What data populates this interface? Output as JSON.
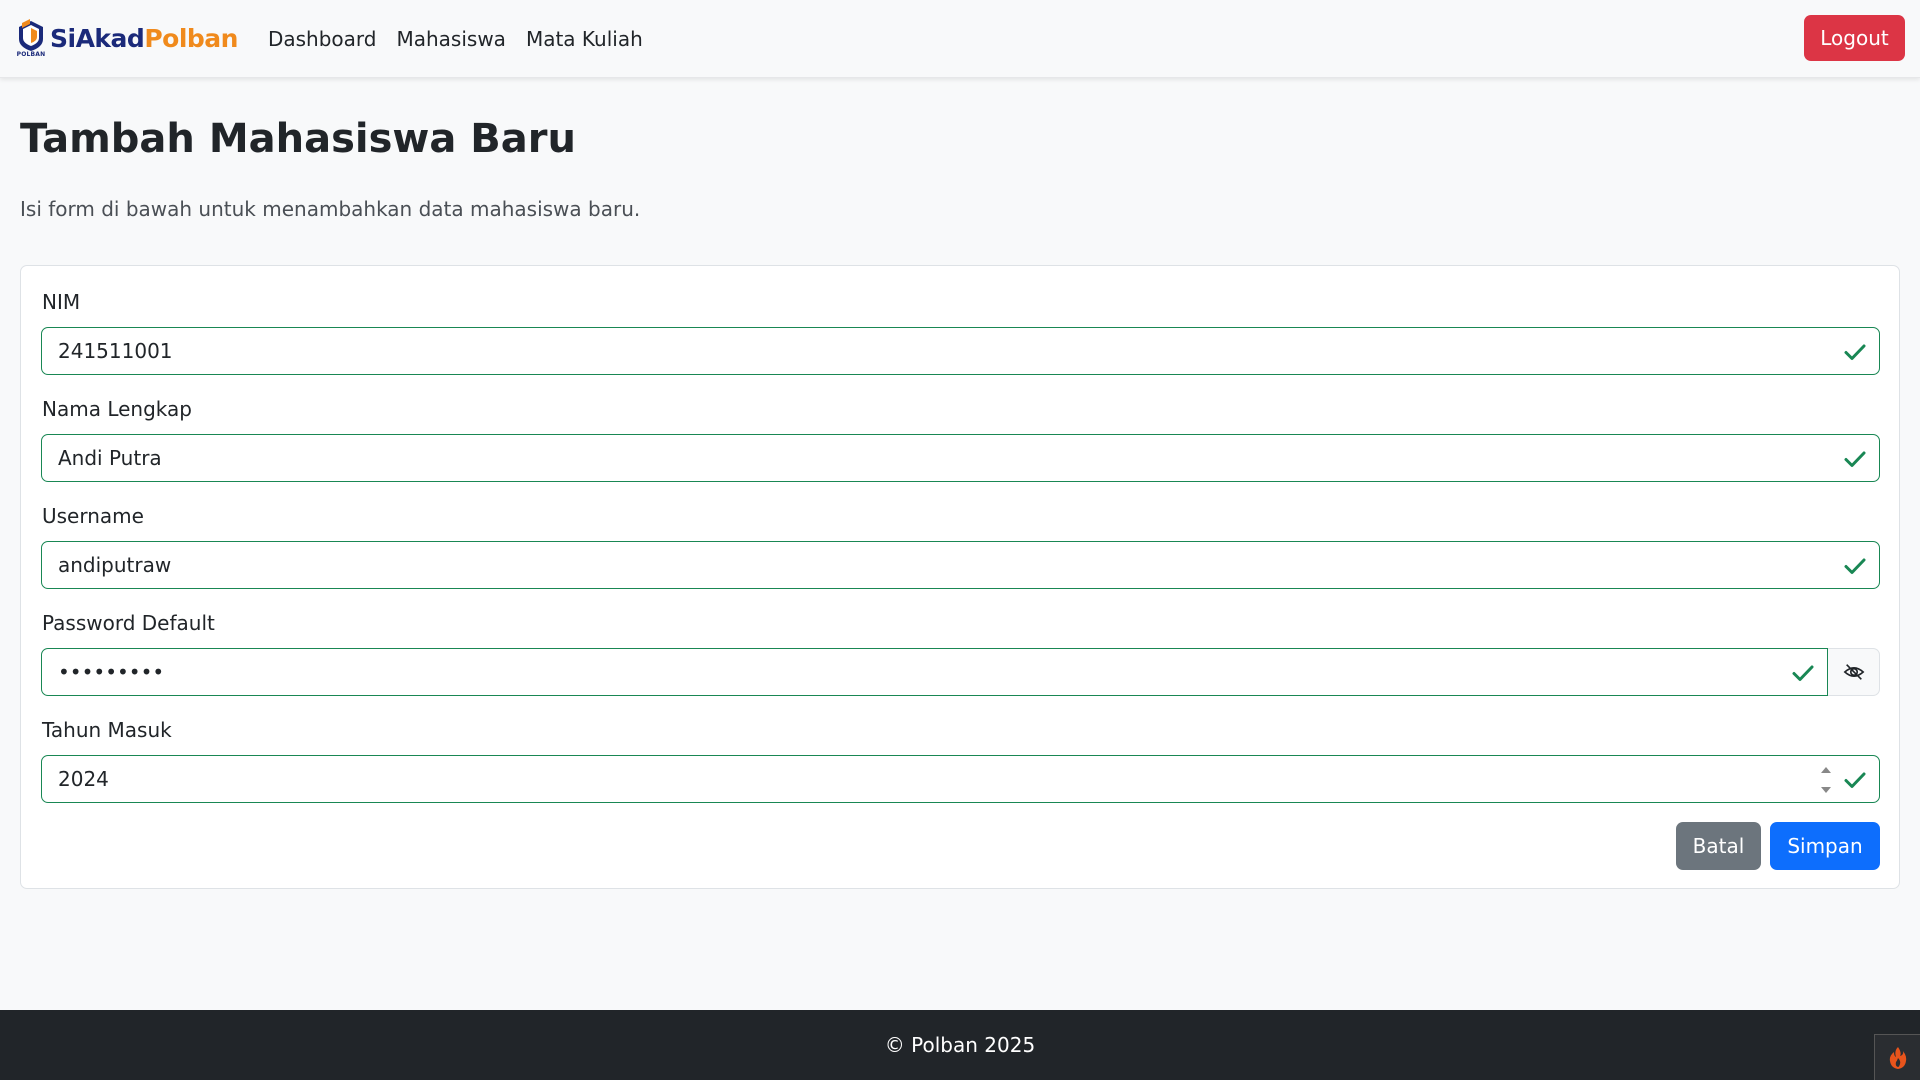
{
  "navbar": {
    "brand_part1": "SiAkad",
    "brand_part2": "Polban",
    "brand_logo_text": "POLBAN",
    "links": [
      "Dashboard",
      "Mahasiswa",
      "Mata Kuliah"
    ],
    "logout_label": "Logout"
  },
  "page": {
    "title": "Tambah Mahasiswa Baru",
    "description": "Isi form di bawah untuk menambahkan data mahasiswa baru."
  },
  "form": {
    "nim_label": "NIM",
    "nim_value": "241511001",
    "nama_label": "Nama Lengkap",
    "nama_value": "Andi Putra",
    "username_label": "Username",
    "username_value": "andiputraw",
    "password_label": "Password Default",
    "password_value": "•••••••••",
    "tahun_label": "Tahun Masuk",
    "tahun_value": "2024",
    "batal_label": "Batal",
    "simpan_label": "Simpan"
  },
  "footer": {
    "text": "© Polban 2025"
  },
  "icons": {
    "valid": "check-icon",
    "password_toggle": "eye-slash-icon",
    "debug": "flame-icon"
  },
  "colors": {
    "valid_green": "#198754",
    "logout_red": "#dc3545",
    "primary_blue": "#0d6efd",
    "secondary_gray": "#6c757d",
    "brand_navy": "#1b2a7a",
    "brand_orange": "#f08a1c",
    "footer_dark": "#212529"
  }
}
